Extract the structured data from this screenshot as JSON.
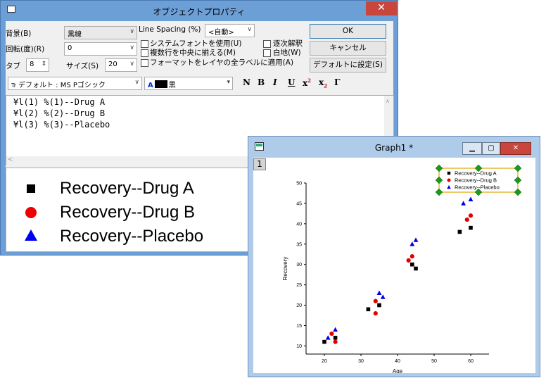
{
  "dialog": {
    "title": "オブジェクトプロパティ",
    "close_glyph": "✕",
    "background_label": "背景(B)",
    "background_value": "黒線",
    "rotation_label": "回転(度)(R)",
    "rotation_value": "0",
    "tab_label": "タブ",
    "tab_value": "8",
    "size_label": "サイズ(S)",
    "size_value": "20",
    "line_spacing_label": "Line Spacing (%)",
    "line_spacing_value": "<自動>",
    "check_system_font": "システムフォントを使用(U)",
    "check_center_multi": "複数行を中央に揃える(M)",
    "check_apply_all": "フォーマットをレイヤの全ラベルに適用(A)",
    "check_sequential": "逐次解釈",
    "check_white_bg": "白地(W)",
    "ok_label": "OK",
    "cancel_label": "キャンセル",
    "default_label": "デフォルトに設定(S)",
    "font_value": "デフォルト : MS Pゴシック",
    "font_icon_text": "Tr",
    "color_value": "黒",
    "color_A": "A",
    "fmt_normal": "N",
    "fmt_bold": "B",
    "fmt_italic": "I",
    "fmt_underline": "U",
    "fmt_super": "x",
    "fmt_super_mark": "2",
    "fmt_sub": "x",
    "fmt_sub_mark": "2",
    "fmt_greek": "Γ",
    "text_lines": [
      "¥l(1) %(1)--Drug A",
      "¥l(2) %(2)--Drug B",
      "¥l(3) %(3)--Placebo"
    ],
    "preview": [
      "Recovery--Drug A",
      "Recovery--Drug B",
      "Recovery--Placebo"
    ]
  },
  "graph": {
    "title": "Graph1 *",
    "layer": "1",
    "legend": [
      "Recovery--Drug A",
      "Recovery--Drug B",
      "Recovery--Placebo"
    ]
  },
  "chart_data": {
    "type": "scatter",
    "xlabel": "Age",
    "ylabel": "Recovery",
    "xlim": [
      15,
      65
    ],
    "ylim": [
      8,
      50
    ],
    "xticks": [
      20,
      30,
      40,
      50,
      60
    ],
    "yticks": [
      10,
      15,
      20,
      25,
      30,
      35,
      40,
      45,
      50
    ],
    "series": [
      {
        "name": "Recovery--Drug A",
        "marker": "square",
        "color": "#000000",
        "x": [
          20,
          23,
          32,
          35,
          44,
          45,
          57,
          60
        ],
        "y": [
          11,
          12,
          19,
          20,
          30,
          29,
          38,
          39
        ]
      },
      {
        "name": "Recovery--Drug B",
        "marker": "circle",
        "color": "#e00000",
        "x": [
          22,
          23,
          34,
          34,
          43,
          44,
          59,
          60
        ],
        "y": [
          13,
          11,
          21,
          18,
          31,
          32,
          41,
          42
        ]
      },
      {
        "name": "Recovery--Placebo",
        "marker": "triangle",
        "color": "#0000e0",
        "x": [
          21,
          23,
          35,
          36,
          44,
          45,
          58,
          60
        ],
        "y": [
          12,
          14,
          23,
          22,
          35,
          36,
          45,
          46
        ]
      }
    ]
  }
}
